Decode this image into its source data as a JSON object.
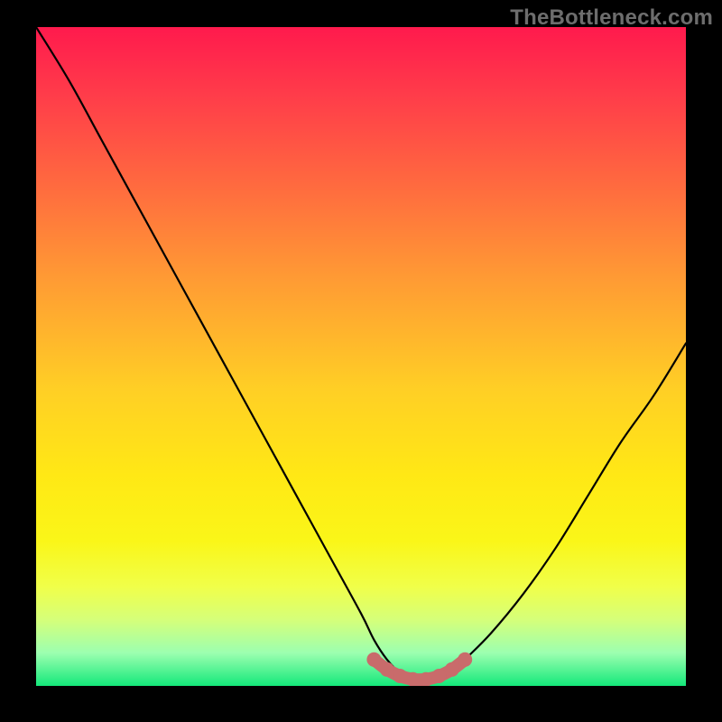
{
  "watermark": "TheBottleneck.com",
  "chart_data": {
    "type": "line",
    "title": "",
    "xlabel": "",
    "ylabel": "",
    "xlim": [
      0,
      100
    ],
    "ylim": [
      0,
      100
    ],
    "series": [
      {
        "name": "bottleneck-curve",
        "x": [
          0,
          5,
          10,
          15,
          20,
          25,
          30,
          35,
          40,
          45,
          50,
          52,
          54,
          56,
          58,
          60,
          62,
          64,
          66,
          70,
          75,
          80,
          85,
          90,
          95,
          100
        ],
        "values": [
          100,
          92,
          83,
          74,
          65,
          56,
          47,
          38,
          29,
          20,
          11,
          7,
          4,
          2,
          1,
          1,
          1,
          2,
          4,
          8,
          14,
          21,
          29,
          37,
          44,
          52
        ]
      },
      {
        "name": "bottleneck-valley-highlight",
        "x": [
          52,
          54,
          56,
          58,
          60,
          62,
          64,
          66
        ],
        "values": [
          4,
          2.5,
          1.5,
          1,
          1,
          1.5,
          2.5,
          4
        ]
      }
    ],
    "colors": {
      "curve": "#000000",
      "highlight": "#c96b6b",
      "gradient_top": "#ff1a4d",
      "gradient_mid": "#ffd722",
      "gradient_bottom": "#14e87a"
    }
  }
}
